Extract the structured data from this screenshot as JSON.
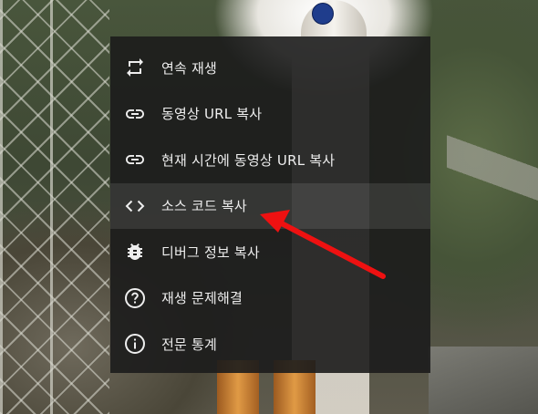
{
  "context_menu": {
    "items": [
      {
        "label": "연속 재생",
        "icon": "loop-icon"
      },
      {
        "label": "동영상 URL 복사",
        "icon": "link-icon"
      },
      {
        "label": "현재 시간에 동영상 URL 복사",
        "icon": "link-icon"
      },
      {
        "label": "소스 코드 복사",
        "icon": "code-brackets-icon",
        "highlighted": true
      },
      {
        "label": "디버그 정보 복사",
        "icon": "bug-icon"
      },
      {
        "label": "재생 문제해결",
        "icon": "question-circle-icon"
      },
      {
        "label": "전문 통계",
        "icon": "info-circle-icon"
      }
    ]
  },
  "annotation": {
    "color": "#ee1111",
    "points_to": "소스 코드 복사"
  }
}
